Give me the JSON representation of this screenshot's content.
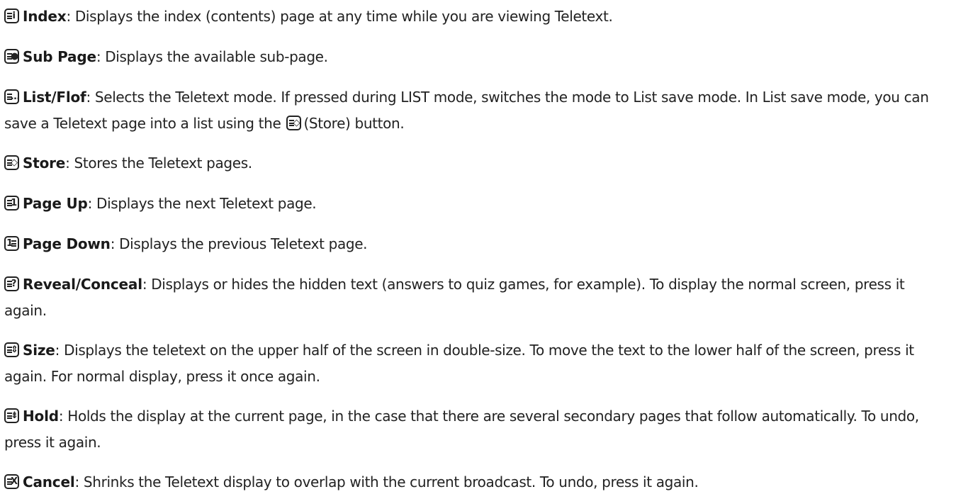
{
  "entries": [
    {
      "icon": "index-icon",
      "glyph": "i",
      "term": "Index",
      "desc": ": Displays the index (contents) page at any time while you are viewing Teletext."
    },
    {
      "icon": "sub-page-icon",
      "glyph": "●",
      "term": "Sub Page",
      "desc": ": Displays the available sub-page."
    },
    {
      "icon": "list-flof-icon",
      "glyph": "…",
      "term": "List/Flof",
      "desc_part1": ": Selects the Teletext mode. If pressed during LIST mode, switches the mode to List save mode. In List save mode, you can save a Teletext page into a list using the",
      "desc_part2": "(Store) button.",
      "inline_icon": "store-icon",
      "inline_glyph": "◇"
    },
    {
      "icon": "store-icon",
      "glyph": "◇",
      "term": "Store",
      "desc": ": Stores the Teletext pages."
    },
    {
      "icon": "page-up-icon",
      "glyph": "1",
      "term": "Page Up",
      "desc": ": Displays the next Teletext page."
    },
    {
      "icon": "page-down-icon",
      "glyph": "1",
      "term": "Page Down",
      "desc": ": Displays the previous Teletext page."
    },
    {
      "icon": "reveal-conceal-icon",
      "glyph": "?",
      "term": "Reveal/Conceal",
      "desc": ": Displays or hides the hidden text (answers to quiz games, for example). To display the normal screen, press it again."
    },
    {
      "icon": "size-icon",
      "glyph": "⇕",
      "term": "Size",
      "desc": ": Displays the teletext on the upper half of the screen in double-size. To move the text to the lower half of the screen, press it again. For normal display, press it once again."
    },
    {
      "icon": "hold-icon",
      "glyph": "⇟",
      "term": "Hold",
      "desc": ": Holds the display at the current page, in the case that there are several secondary pages that follow automatically. To undo, press it again."
    },
    {
      "icon": "cancel-icon",
      "glyph": "X",
      "term": "Cancel",
      "desc": ": Shrinks the Teletext display to overlap with the current broadcast. To undo, press it again."
    }
  ]
}
